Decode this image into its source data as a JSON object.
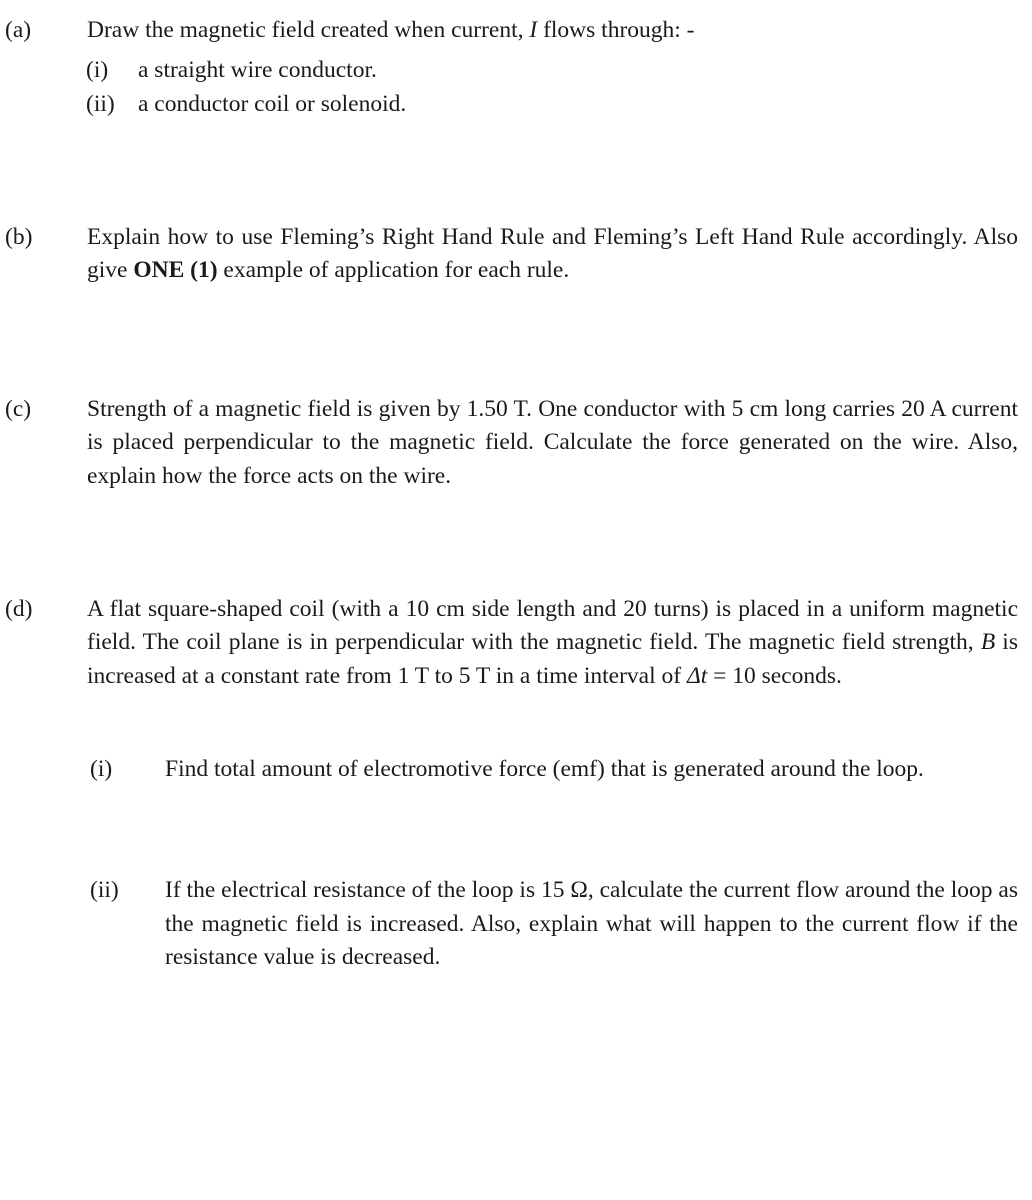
{
  "document": {
    "type": "exam-question-sheet",
    "text_color": "#1a1a1a",
    "background_color": "#ffffff"
  },
  "questions": [
    {
      "label": "(a)",
      "text_before_italic": "Draw the magnetic field created when current, ",
      "italic_symbol": "I",
      "text_after_italic": " flows through: -",
      "subitems": [
        {
          "label": "(i)",
          "text": "a straight wire conductor."
        },
        {
          "label": "(ii)",
          "text": "a conductor coil or solenoid."
        }
      ]
    },
    {
      "label": "(b)",
      "text_part1": "Explain how to use Fleming’s Right Hand Rule and Fleming’s Left Hand Rule accordingly. Also give ",
      "bold_phrase": "ONE (1)",
      "text_part2": " example of application for each rule."
    },
    {
      "label": "(c)",
      "text": "Strength of a magnetic field is given by 1.50 T. One conductor with 5 cm long carries 20 A current is placed perpendicular to the magnetic field. Calculate the force generated on the wire. Also, explain how the force acts on the wire."
    },
    {
      "label": "(d)",
      "text_part1": "A flat square-shaped coil (with a 10 cm side length and 20 turns) is placed in a uniform magnetic field. The coil plane is in perpendicular with the magnetic field. The magnetic field strength, ",
      "italic_symbol_1": "B",
      "text_part2": " is increased at a constant rate from 1 T to 5 T in a time interval of ",
      "italic_symbol_2": "Δt",
      "text_part3": " = 10 seconds.",
      "subitems": [
        {
          "label": "(i)",
          "text": "Find total amount of electromotive force (emf) that is generated around the loop."
        },
        {
          "label": "(ii)",
          "text_part1": "If the electrical resistance of the loop is 15 ",
          "ohm_symbol": "Ω",
          "text_part2": ", calculate the current flow around the loop as the magnetic field is increased. Also, explain what will happen to the current flow if the resistance value is decreased."
        }
      ]
    }
  ]
}
